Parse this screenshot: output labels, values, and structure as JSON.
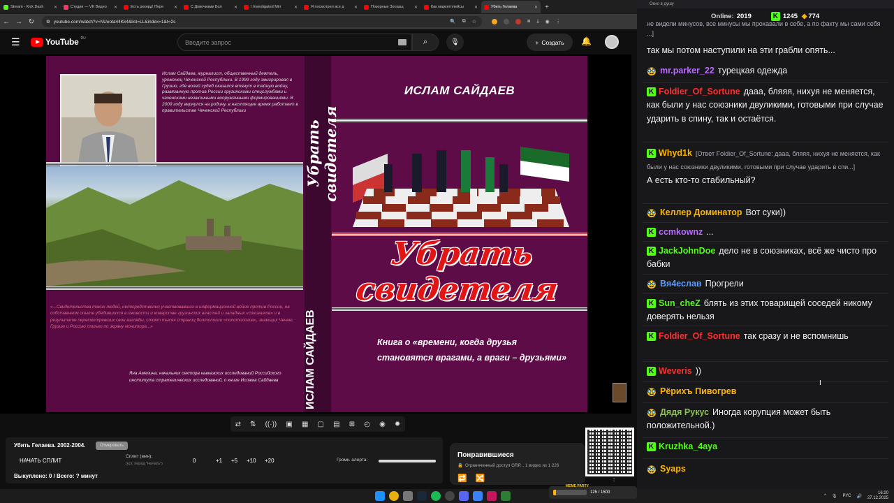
{
  "browser": {
    "tabs": [
      {
        "label": "Stream - Kick Dash",
        "color": "#53fc18"
      },
      {
        "label": "Студия — VK Видео",
        "color": "#ff3366"
      },
      {
        "label": "Есть рекорд! Пере",
        "color": "#ff0000"
      },
      {
        "label": "С Девочками Бол",
        "color": "#ff0000"
      },
      {
        "label": "I Investigated Mirr",
        "color": "#ff0000"
      },
      {
        "label": "Я посмотрел все д",
        "color": "#ff0000"
      },
      {
        "label": "Позорные Зоозащ",
        "color": "#ff0000"
      },
      {
        "label": "Как маркетплейсы",
        "color": "#ff0000"
      },
      {
        "label": "Убить Гелаева",
        "color": "#ff0000"
      }
    ],
    "url": "youtube.com/watch?v=NUeota44Kk4&list=LL&index=1&t=2s"
  },
  "youtube": {
    "logo_text": "YouTube",
    "logo_region": "RU",
    "search_placeholder": "Введите запрос",
    "create_label": "Создать"
  },
  "video": {
    "cover_author": "ИСЛАМ САЙДАЕВ",
    "cover_title": "Убрать свидетеля",
    "cover_subtitle": "Книга о «времени, когда друзья становятся врагами, а враги – друзьями»",
    "spine_title": "Убрать свидетеля",
    "spine_author": "ИСЛАМ САЙДАЕВ",
    "bio": "Ислам Сайдаев, журналист, общественный деятель, уроженец Чеченской Республики. В 1999 году эмигрировал в Грузию, где волей судеб оказался втянут в тайную войну, развязанную против России грузинскими спецслужбами и чеченскими незаконными вооруженными формированиями. В 2009 году вернулся на родину, в настоящее время работает в правительстве Чеченской Республики",
    "quote": "«...Свидетельства таких людей, непосредственно участвовавших в информационной войне против России, на собственном опыте убедившихся в лживости и коварстве грузинских властей и западных «союзников» и в результате пересмотревших свои взгляды, стоят тысяч страниц болтологии «политологов», знающих Чечню, Грузию и Россию только по экрану монитора...»",
    "quote_sig": "Яна Амелина, начальник сектора кавказских исследований Российского института стратегических исследований, о книге Ислама Сайдаева"
  },
  "controls": {
    "icons": [
      "repeat-icon",
      "sort-icon",
      "broadcast-icon",
      "miniplayer-icon",
      "calendar-icon",
      "screen-icon",
      "subtitles-icon",
      "add-icon",
      "speed-icon",
      "camera-icon",
      "settings-icon"
    ],
    "glyphs": [
      "⇄",
      "⇅",
      "((·))",
      "▣",
      "▦",
      "▢",
      "▤",
      "⊞",
      "◴",
      "◉",
      "✹"
    ]
  },
  "split": {
    "title": "Убить Гелаева. 2002-2004.",
    "badge": "Отмеровать",
    "start_label": "НАЧАТЬ СПЛИТ",
    "split_label": "Сплит (мин):",
    "split_sub": "(уст. перед \"Начать\")",
    "values": [
      "0",
      "+1",
      "+5",
      "+10",
      "+20"
    ],
    "alert_label": "Громк. алерта:",
    "alert_level": 1.0,
    "footer": "Выкуплено: 0 / Всего: ? минут"
  },
  "liked": {
    "title": "Понравившиеся",
    "meta": "Ограниченный доступ GRP...   1 видео из 1 226"
  },
  "chat": {
    "window_title": "Окно в душу",
    "online_label": "Online:",
    "online_count": "2019",
    "kick_count": "1245",
    "other_count": "774",
    "top_fragment": "не видели минусов, все минусы мы прохавали в себе, а по факту мы сами себя ...]",
    "top_text": "так мы потом наступили на эти грабли опять...",
    "messages": [
      {
        "user": "mr.parker_22",
        "color": "#b86bff",
        "badge": "other",
        "text": "турецкая одежда"
      },
      {
        "user": "Foldier_Of_Sortune",
        "color": "#ff3030",
        "badge": "kick",
        "text": "дааа, бляяя, нихуя не меняется, как были у нас союзники двуликими, готовыми при случае ударить в спину, так и остаётся."
      },
      {
        "user": "Whyd1k",
        "color": "#ffb400",
        "badge": "kick",
        "reply": "[Ответ Foldier_Of_Sortune: дааа, бляяя, нихуя не меняется, как были у нас союзники двуликими, готовыми при случае ударить в спи...]",
        "text": "А есть кто-то стабильный?"
      },
      {
        "user": "Келлер Доминатор",
        "color": "#ffb400",
        "badge": "other",
        "text": "Вот суки))"
      },
      {
        "user": "ccmkownz",
        "color": "#b86bff",
        "badge": "kick",
        "text": "..."
      },
      {
        "user": "JackJohnDoe",
        "color": "#53fc18",
        "badge": "kick",
        "text": "дело не в союзниках, всё же чисто про бабки"
      },
      {
        "user": "Вя4еслав",
        "color": "#5b9bff",
        "badge": "other",
        "text": "Прогрели"
      },
      {
        "user": "Sun_cheZ",
        "color": "#53fc18",
        "badge": "kick",
        "text": "блять из этих товарищей соседей никому доверять нельзя"
      },
      {
        "user": "Foldier_Of_Sortune",
        "color": "#ff3030",
        "badge": "kick",
        "text": "так сразу и не вспомнишь"
      },
      {
        "user": "Weveris",
        "color": "#ff3030",
        "badge": "kick",
        "text": "))"
      },
      {
        "user": "Рёрихъ Пивогрев",
        "color": "#ffb400",
        "badge": "other",
        "text": ""
      },
      {
        "user": "Дядя Рукус",
        "color": "#8bc34a",
        "badge": "other",
        "text": "Иногда корупция может быть положительной.)"
      },
      {
        "user": "Kruzhka_4aya",
        "color": "#53fc18",
        "badge": "kick",
        "text": ""
      },
      {
        "user": "Syaps",
        "color": "#ffb400",
        "badge": "other",
        "text": ""
      }
    ]
  },
  "taskbar": {
    "lang": "РУС",
    "time": "16:20",
    "date": "27.12.2025",
    "widget_label": "MEME PARTY",
    "widget_count": "125 / 1500",
    "widget_progress": 0.083
  }
}
